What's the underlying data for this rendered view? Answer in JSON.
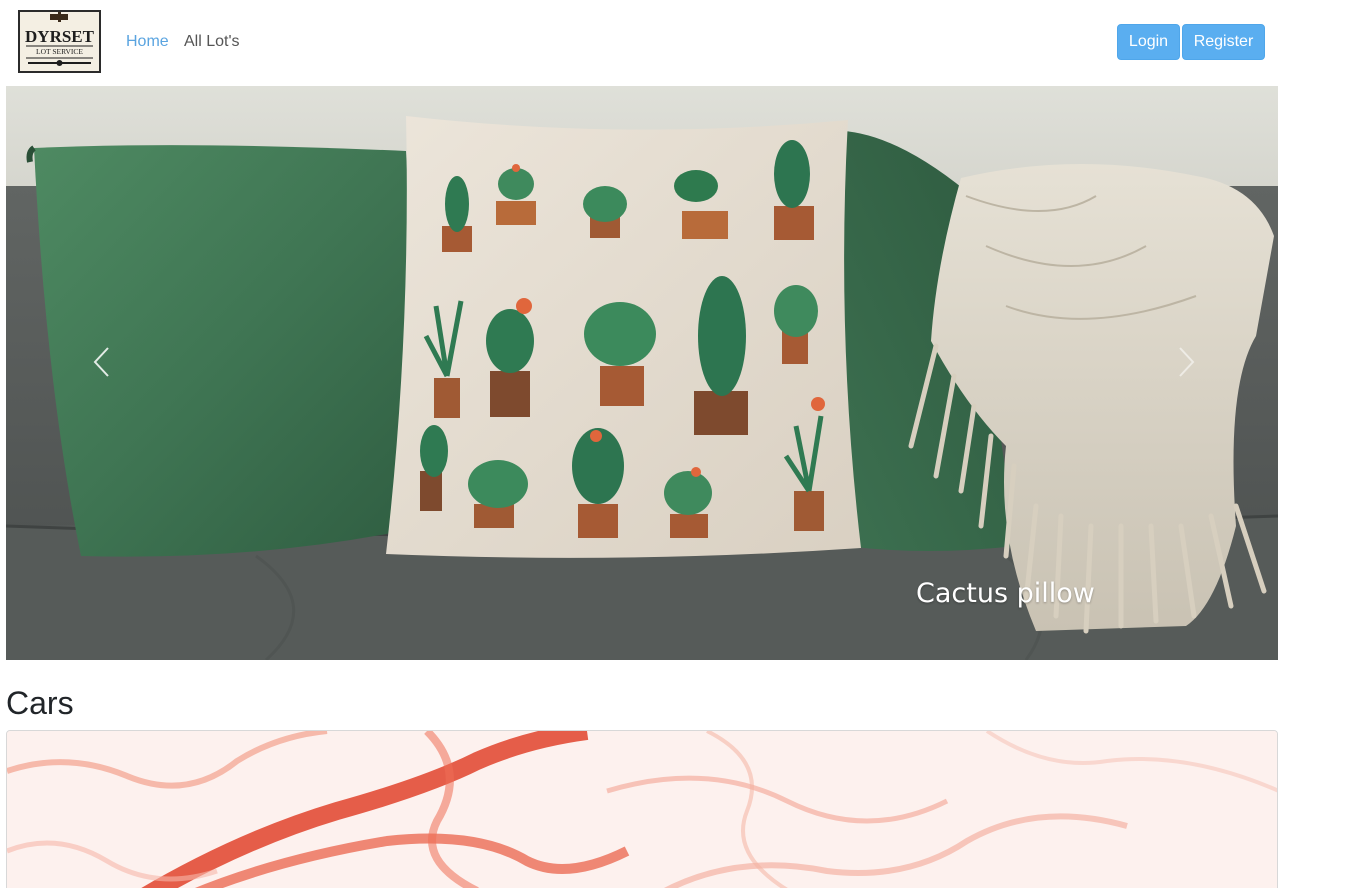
{
  "brand": {
    "logo_icon": "gavel-logo-icon",
    "logo_text_top": "DYRSET",
    "logo_text_bottom": "LOT SERVICE",
    "accent_color": "#5aaef0"
  },
  "nav": {
    "items": [
      {
        "label": "Home",
        "active": true
      },
      {
        "label": "All Lot's",
        "active": false
      }
    ]
  },
  "auth": {
    "login_label": "Login",
    "register_label": "Register"
  },
  "carousel": {
    "caption": "Cactus pillow",
    "prev_icon": "chevron-left-icon",
    "next_icon": "chevron-right-icon"
  },
  "sections": [
    {
      "title": "Cars"
    }
  ]
}
